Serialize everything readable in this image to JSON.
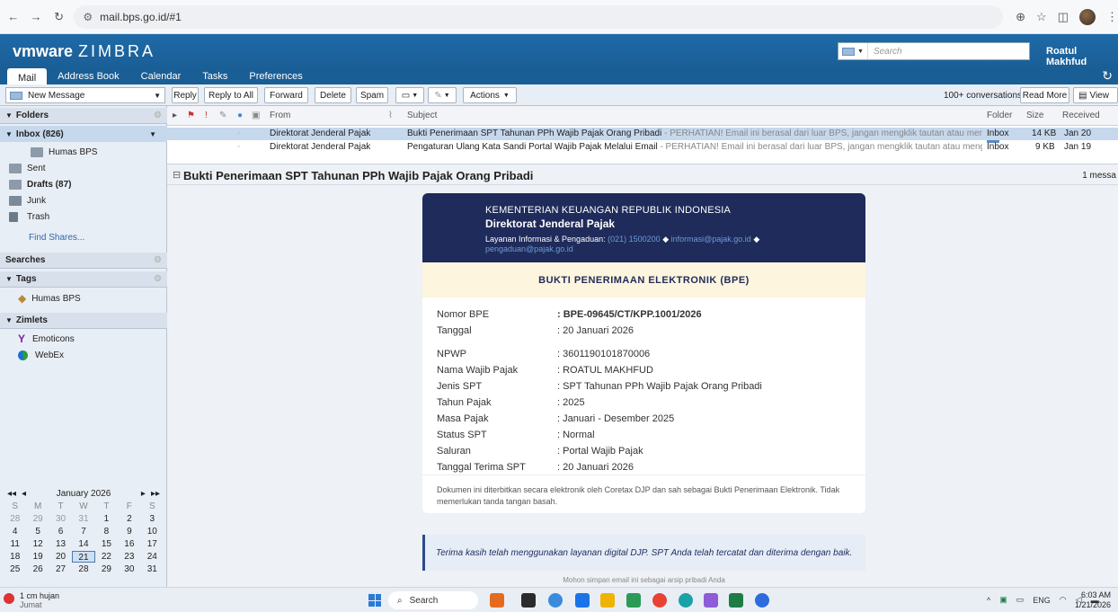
{
  "browser": {
    "url": "mail.bps.go.id/#1"
  },
  "header": {
    "logo_brand": "vmware",
    "logo_product": "ZIMBRA",
    "search_placeholder": "Search",
    "user_name": "Roatul Makhfud"
  },
  "tabs": [
    {
      "label": "Mail"
    },
    {
      "label": "Address Book"
    },
    {
      "label": "Calendar"
    },
    {
      "label": "Tasks"
    },
    {
      "label": "Preferences"
    }
  ],
  "toolbar": {
    "new_message": "New Message",
    "reply": "Reply",
    "reply_all": "Reply to All",
    "forward": "Forward",
    "delete": "Delete",
    "spam": "Spam",
    "actions": "Actions",
    "conversations": "100+ conversations",
    "read_more": "Read More",
    "view": "View"
  },
  "sidebar": {
    "folders_title": "Folders",
    "inbox": "Inbox (826)",
    "humas_folder": "Humas BPS",
    "sent": "Sent",
    "drafts": "Drafts (87)",
    "junk": "Junk",
    "trash": "Trash",
    "find_shares": "Find Shares...",
    "searches_title": "Searches",
    "tags_title": "Tags",
    "tag_humas": "Humas BPS",
    "zimlets_title": "Zimlets",
    "emoticons": "Emoticons",
    "webex": "WebEx"
  },
  "calendar": {
    "month": "January 2026",
    "days": [
      "S",
      "M",
      "T",
      "W",
      "T",
      "F",
      "S"
    ],
    "weeks": [
      [
        "28",
        "29",
        "30",
        "31",
        "1",
        "2",
        "3"
      ],
      [
        "4",
        "5",
        "6",
        "7",
        "8",
        "9",
        "10"
      ],
      [
        "11",
        "12",
        "13",
        "14",
        "15",
        "16",
        "17"
      ],
      [
        "18",
        "19",
        "20",
        "21",
        "22",
        "23",
        "24"
      ],
      [
        "25",
        "26",
        "27",
        "28",
        "29",
        "30",
        "31"
      ]
    ]
  },
  "list": {
    "col_from": "From",
    "col_subject": "Subject",
    "col_folder": "Folder",
    "col_size": "Size",
    "col_received": "Received",
    "rows": [
      {
        "from": "Direktorat Jenderal Pajak",
        "subject": "Bukti Penerimaan SPT Tahunan PPh Wajib Pajak Orang Pribadi",
        "fragment": " - PERHATIAN! Email ini berasal dari luar BPS, jangan mengklik tautan atau mengunduh lampiran ( atta",
        "folder": "Inbox",
        "size": "14 KB",
        "received": "Jan 20"
      },
      {
        "from": "Direktorat Jenderal Pajak",
        "subject": "Pengaturan Ulang Kata Sandi Portal Wajib Pajak Melalui Email",
        "fragment": " - PERHATIAN! Email ini berasal dari luar BPS, jangan mengklik tautan atau mengunduh lampiran ( atta",
        "folder": "Inbox",
        "size": "9 KB",
        "received": "Jan 19"
      }
    ]
  },
  "reading": {
    "title": "Bukti Penerimaan SPT Tahunan PPh Wajib Pajak Orang Pribadi",
    "count": "1 messa"
  },
  "email": {
    "ministry": "KEMENTERIAN KEUANGAN REPUBLIK INDONESIA",
    "directorate": "Direktorat Jenderal Pajak",
    "service_label": "Layanan Informasi & Pengaduan:",
    "phone": "(021) 1500200",
    "email1": "informasi@pajak.go.id",
    "email2": "pengaduan@pajak.go.id",
    "bpe_title": "BUKTI PENERIMAAN ELEKTRONIK (BPE)",
    "fields": [
      {
        "label": "Nomor BPE",
        "value": ": BPE-09645/CT/KPP.1001/2026"
      },
      {
        "label": "Tanggal",
        "value": ": 20 Januari 2026"
      },
      {
        "label": "NPWP",
        "value": ": 3601190101870006"
      },
      {
        "label": "Nama Wajib Pajak",
        "value": ": ROATUL MAKHFUD"
      },
      {
        "label": "Jenis SPT",
        "value": ": SPT Tahunan PPh Wajib Pajak Orang Pribadi"
      },
      {
        "label": "Tahun Pajak",
        "value": ": 2025"
      },
      {
        "label": "Masa Pajak",
        "value": ": Januari - Desember 2025"
      },
      {
        "label": "Status SPT",
        "value": ": Normal"
      },
      {
        "label": "Saluran",
        "value": ": Portal Wajib Pajak"
      },
      {
        "label": "Tanggal Terima SPT",
        "value": ": 20 Januari 2026"
      }
    ],
    "note": "Dokumen ini diterbitkan secara elektronik oleh Coretax DJP dan sah sebagai Bukti Penerimaan Elektronik. Tidak memerlukan tanda tangan basah.",
    "thanks": "Terima kasih telah menggunakan layanan digital DJP. SPT Anda telah tercatat dan diterima dengan baik.",
    "save_note": "Mohon simpan email ini sebagai arsip pribadi Anda"
  },
  "taskbar": {
    "weather_line1": "1 cm hujan",
    "weather_line2": "Jumat",
    "search": "Search",
    "lang": "ENG",
    "time": "6:03 AM",
    "date": "1/21/2026"
  },
  "colors": {
    "zimbra_blue": "#1a5e96",
    "banner_navy": "#1f2b5a",
    "bpe_cream": "#fdf5de",
    "selected_row": "#c6d8ec"
  }
}
